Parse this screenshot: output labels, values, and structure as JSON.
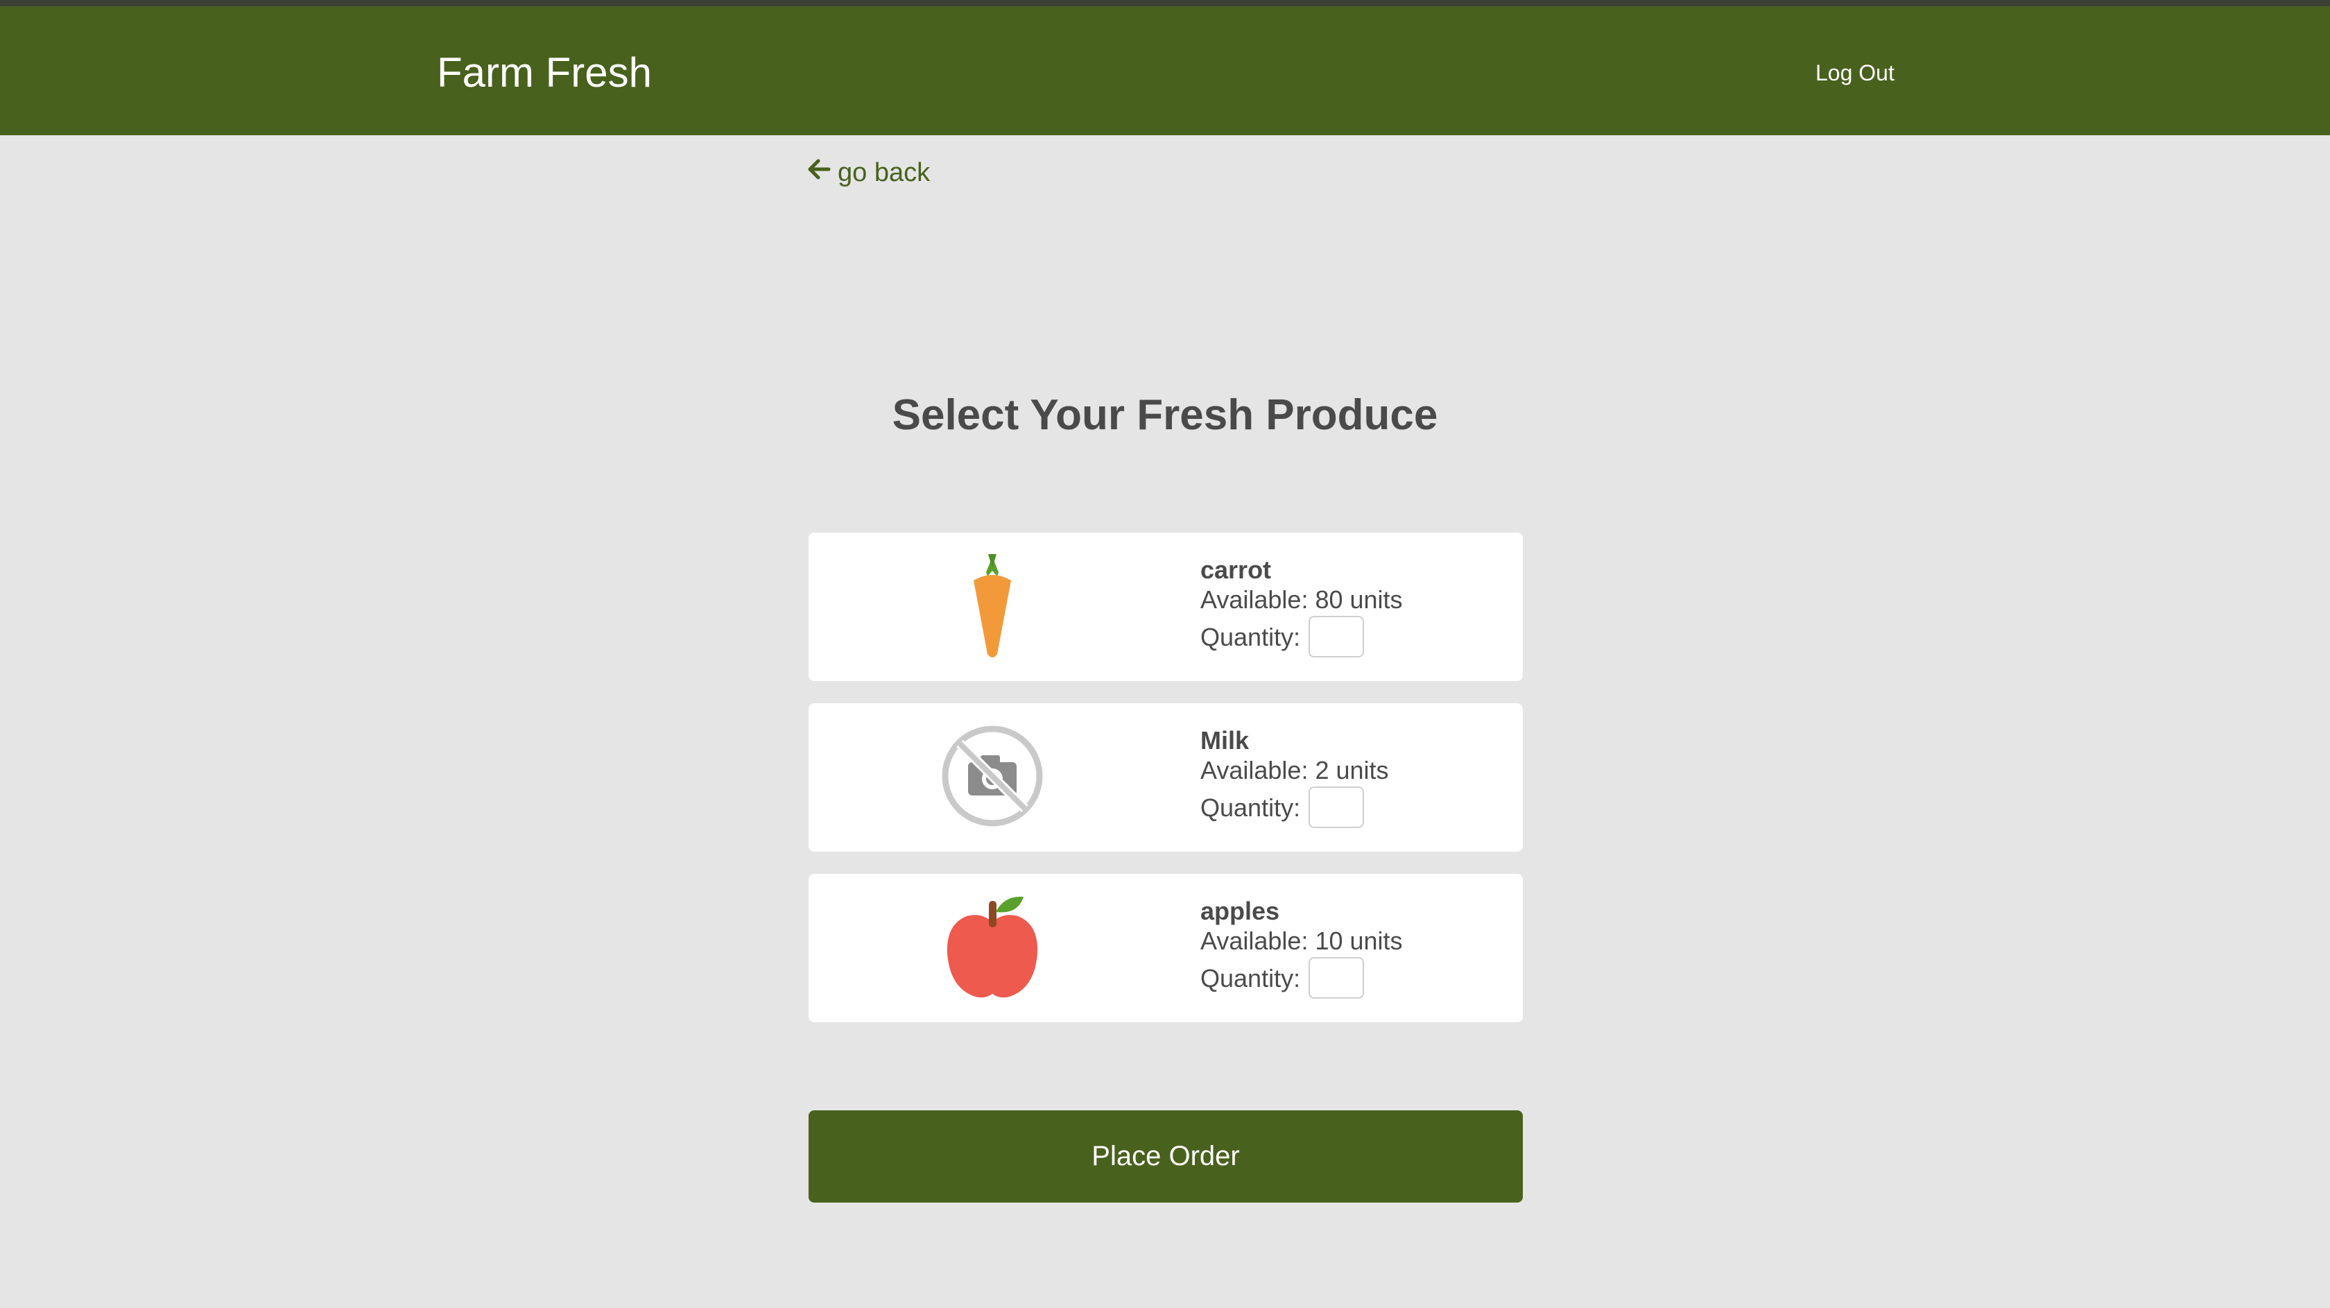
{
  "header": {
    "brand": "Farm Fresh",
    "logout_label": "Log Out"
  },
  "nav": {
    "back_label": "go back",
    "back_icon": "arrow-left-icon"
  },
  "page": {
    "title": "Select Your Fresh Produce"
  },
  "products": [
    {
      "name": "carrot",
      "available": "Available: 80 units",
      "quantity_label": "Quantity:",
      "quantity_value": "",
      "icon": "carrot-icon"
    },
    {
      "name": "Milk",
      "available": "Available: 2 units",
      "quantity_label": "Quantity:",
      "quantity_value": "",
      "icon": "no-image-icon"
    },
    {
      "name": "apples",
      "available": "Available: 10 units",
      "quantity_label": "Quantity:",
      "quantity_value": "",
      "icon": "apple-icon"
    }
  ],
  "actions": {
    "place_order_label": "Place Order"
  },
  "colors": {
    "brand_green": "#48611d",
    "background": "#e5e5e5",
    "card": "#ffffff",
    "text": "#4a4a4a"
  }
}
